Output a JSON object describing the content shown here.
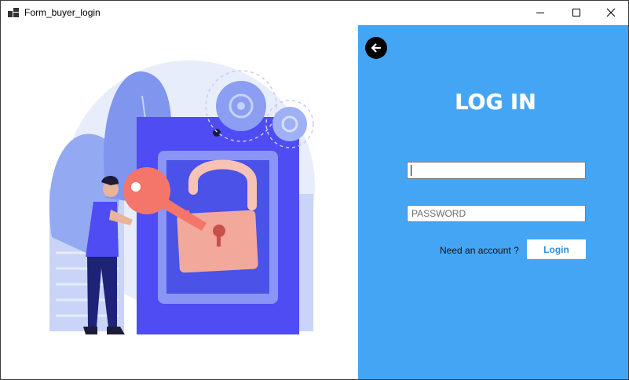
{
  "window": {
    "title": "Form_buyer_login",
    "minimize_icon": "minimize-icon",
    "maximize_icon": "maximize-icon",
    "close_icon": "close-icon"
  },
  "colors": {
    "panel_background": "#45a5f5",
    "login_button_text": "#2c8fe0",
    "illustration_primary": "#4e4cf2",
    "illustration_key": "#f4766a"
  },
  "illustration": {
    "description_icon": "security-login-illustration"
  },
  "login_panel": {
    "back_icon": "arrow-left-icon",
    "heading": "LOG IN",
    "username": {
      "value": "",
      "placeholder": ""
    },
    "password": {
      "value": "",
      "placeholder": "PASSWORD"
    },
    "need_account_label": "Need an account ?",
    "login_button_label": "Login"
  }
}
